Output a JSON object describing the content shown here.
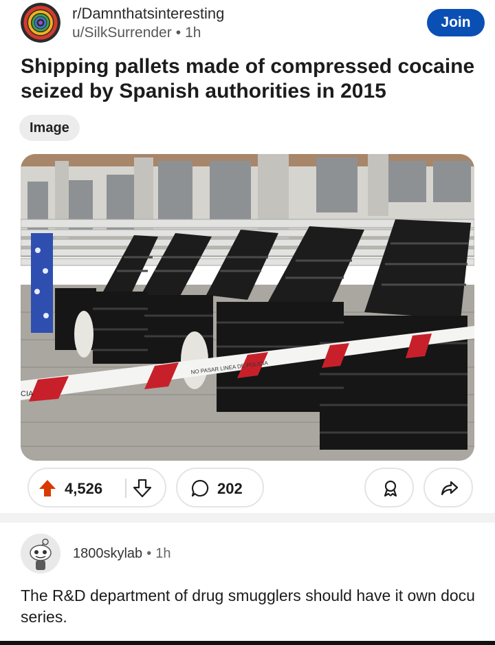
{
  "post": {
    "subreddit": "r/Damnthatsinteresting",
    "author": "u/SilkSurrender",
    "separator_dot": "•",
    "time": "1h",
    "join_label": "Join",
    "title": "Shipping pallets made of compressed cocaine seized by Spanish authorities in 2015",
    "flair": "Image",
    "image_sign_texts": [
      "CIA",
      "NO PASAR LINEA DE POLICIA"
    ]
  },
  "actions": {
    "upvotes": "4,526",
    "comments": "202"
  },
  "comment": {
    "author": "1800skylab",
    "separator_dot": "•",
    "time": "1h",
    "text": "The R&D department of drug smugglers should have it own docu series."
  },
  "colors": {
    "join_button": "#0a4fb4",
    "upvote_active": "#d93a00",
    "police_tape_red": "#c8202a"
  },
  "icons": [
    "subreddit-avatar",
    "upvote-icon",
    "downvote-icon",
    "comment-icon",
    "award-icon",
    "share-icon",
    "snoo-avatar"
  ]
}
